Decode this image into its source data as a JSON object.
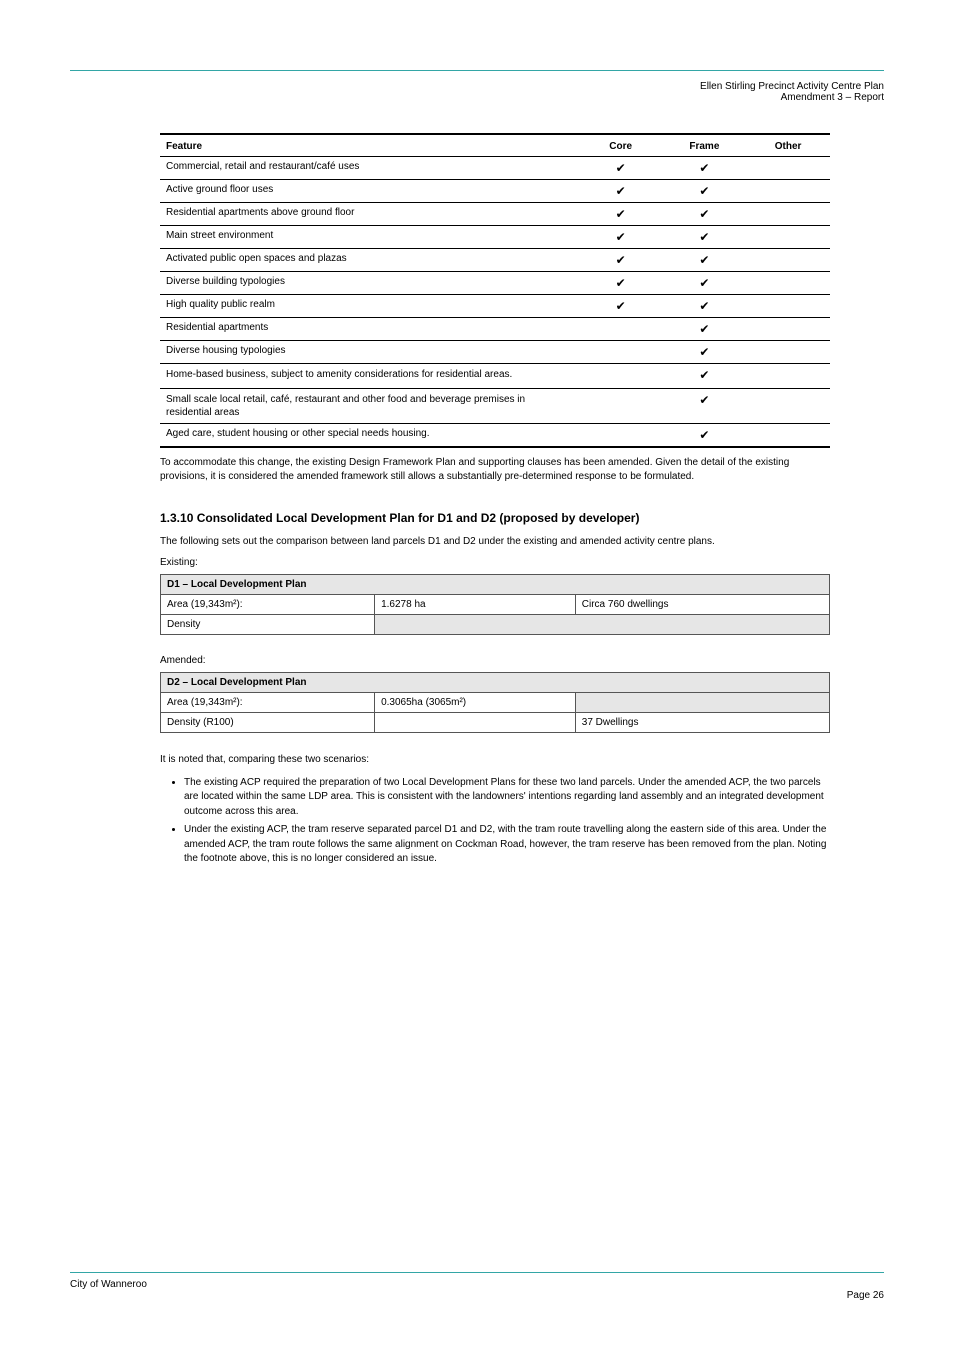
{
  "header": {
    "line1": "Ellen Stirling Precinct Activity Centre Plan",
    "line2": "Amendment 3 – Report"
  },
  "table19": {
    "headers": {
      "feature": "Feature",
      "core": "Core",
      "frame": "Frame",
      "other": "Other"
    },
    "rows": [
      {
        "feature": "Commercial, retail and restaurant/café uses",
        "core": "✔",
        "frame": "✔",
        "other": ""
      },
      {
        "feature": "Active ground floor uses",
        "core": "✔",
        "frame": "✔",
        "other": ""
      },
      {
        "feature": "Residential apartments above ground floor",
        "core": "✔",
        "frame": "✔",
        "other": ""
      },
      {
        "feature": "Main street environment",
        "core": "✔",
        "frame": "✔",
        "other": ""
      },
      {
        "feature": "Activated public open spaces and plazas",
        "core": "✔",
        "frame": "✔",
        "other": ""
      },
      {
        "feature": "Diverse building typologies",
        "core": "✔",
        "frame": "✔",
        "other": ""
      },
      {
        "feature": "High quality public realm",
        "core": "✔",
        "frame": "✔",
        "other": ""
      },
      {
        "feature": "Residential apartments",
        "core": "",
        "frame": "✔",
        "other": ""
      },
      {
        "feature": "Diverse housing typologies",
        "core": "",
        "frame": "✔",
        "other": ""
      },
      {
        "feature": "Home-based business, subject to amenity considerations for residential areas.",
        "core": "",
        "frame": "✔",
        "other": ""
      },
      {
        "feature": "Small scale local retail, café, restaurant and other food and beverage premises in residential areas",
        "core": "",
        "frame": "✔",
        "other": ""
      },
      {
        "feature": "Aged care, student housing or other special needs housing.",
        "core": "",
        "frame": "✔",
        "other": ""
      }
    ]
  },
  "para1": "To accommodate this change, the existing Design Framework Plan and supporting clauses has been amended.  Given the detail of the existing provisions, it is considered the amended framework still allows a substantially pre-determined response to be formulated.",
  "heading": "1.3.10     Consolidated Local Development Plan for D1 and D2 (proposed by developer)",
  "para2": "The following sets out the comparison between land parcels D1 and D2 under the existing and amended activity centre plans.",
  "existing_label": "Existing:",
  "amended_label": "Amended:",
  "tableD1": {
    "title": "D1 – Local Development Plan",
    "cells": {
      "r1c1": "Area (19,343m²):",
      "r1c2": "1.6278 ha",
      "r1c3": "Circa 760 dwellings",
      "r2c1": "Density",
      "r2c2": "",
      "r2c3": ""
    }
  },
  "tableD2": {
    "title": "D2 – Local Development Plan",
    "cells": {
      "r1c1": "Area (19,343m²):",
      "r1c2": "0.3065ha (3065m²)",
      "r1c3": "",
      "r2c1": "Density (R100)",
      "r2c2": "",
      "r2c3": "37 Dwellings"
    }
  },
  "scenario_intro": "It is noted that, comparing these two scenarios:",
  "scenario_bullets": [
    "The existing ACP required the preparation of two Local Development Plans for these two land parcels.  Under the amended ACP, the two parcels are located within the same LDP area.  This is consistent with the landowners' intentions regarding land assembly and an integrated development outcome across this area.",
    "Under the existing ACP, the tram reserve separated parcel D1 and D2, with the tram route travelling along the eastern side of this area.  Under the amended ACP, the tram route follows the same alignment on Cockman Road, however, the tram reserve has been removed from the plan.  Noting the footnote above, this is no longer considered an issue."
  ],
  "footer": {
    "left": "City of Wanneroo",
    "right_line1": "",
    "right_line2": "Page 26"
  }
}
